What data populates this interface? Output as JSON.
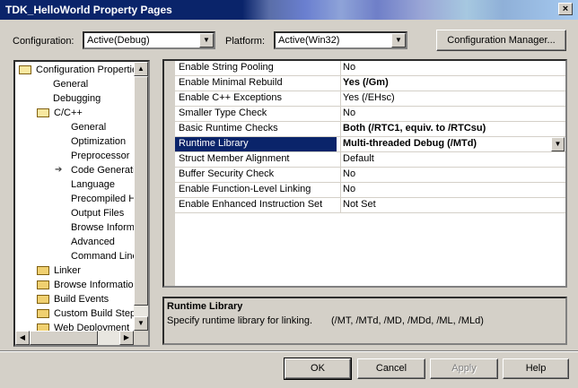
{
  "window": {
    "title": "TDK_HelloWorld Property Pages",
    "close": "×"
  },
  "configuration": {
    "label": "Configuration:",
    "value": "Active(Debug)"
  },
  "platform": {
    "label": "Platform:",
    "value": "Active(Win32)"
  },
  "config_manager": {
    "label": "Configuration Manager..."
  },
  "tree": {
    "items": [
      {
        "label": "Configuration Properties",
        "icon": "folder-open-icon",
        "level": 0
      },
      {
        "label": "General",
        "level": 1
      },
      {
        "label": "Debugging",
        "level": 1
      },
      {
        "label": "C/C++",
        "icon": "folder-open-icon",
        "level": 1
      },
      {
        "label": "General",
        "level": 2
      },
      {
        "label": "Optimization",
        "level": 2
      },
      {
        "label": "Preprocessor",
        "level": 2
      },
      {
        "label": "Code Generation",
        "level": 2,
        "current": true
      },
      {
        "label": "Language",
        "level": 2
      },
      {
        "label": "Precompiled Headers",
        "level": 2
      },
      {
        "label": "Output Files",
        "level": 2
      },
      {
        "label": "Browse Information",
        "level": 2
      },
      {
        "label": "Advanced",
        "level": 2
      },
      {
        "label": "Command Line",
        "level": 2
      },
      {
        "label": "Linker",
        "icon": "folder-icon",
        "level": 1
      },
      {
        "label": "Browse Information",
        "icon": "folder-icon",
        "level": 1
      },
      {
        "label": "Build Events",
        "icon": "folder-icon",
        "level": 1
      },
      {
        "label": "Custom Build Step",
        "icon": "folder-icon",
        "level": 1
      },
      {
        "label": "Web Deployment",
        "icon": "folder-icon",
        "level": 1
      }
    ]
  },
  "properties": [
    {
      "name": "Enable String Pooling",
      "value": "No",
      "bold": false
    },
    {
      "name": "Enable Minimal Rebuild",
      "value": "Yes (/Gm)",
      "bold": true
    },
    {
      "name": "Enable C++ Exceptions",
      "value": "Yes (/EHsc)",
      "bold": false
    },
    {
      "name": "Smaller Type Check",
      "value": "No",
      "bold": false
    },
    {
      "name": "Basic Runtime Checks",
      "value": "Both (/RTC1, equiv. to /RTCsu)",
      "bold": true
    },
    {
      "name": "Runtime Library",
      "value": "Multi-threaded Debug (/MTd)",
      "bold": true,
      "selected": true
    },
    {
      "name": "Struct Member Alignment",
      "value": "Default",
      "bold": false
    },
    {
      "name": "Buffer Security Check",
      "value": "No",
      "bold": false
    },
    {
      "name": "Enable Function-Level Linking",
      "value": "No",
      "bold": false
    },
    {
      "name": "Enable Enhanced Instruction Set",
      "value": "Not Set",
      "bold": false
    }
  ],
  "description": {
    "title": "Runtime Library",
    "text": "Specify runtime library for linking.",
    "options": "(/MT, /MTd, /MD, /MDd, /ML, /MLd)"
  },
  "buttons": {
    "ok": "OK",
    "cancel": "Cancel",
    "apply": "Apply",
    "help": "Help"
  },
  "colors": {
    "selection": "#0a246a",
    "face": "#d4d0c8",
    "disabled_text": "#808080"
  }
}
